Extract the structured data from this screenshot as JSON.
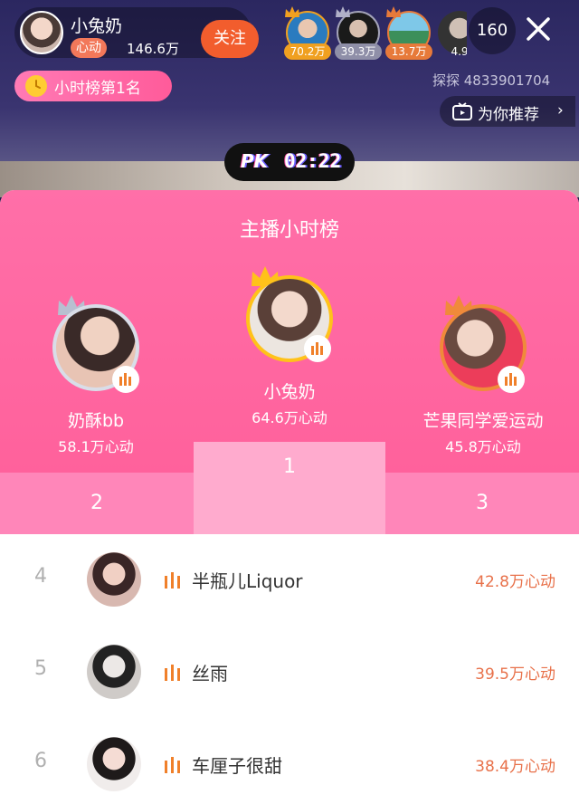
{
  "host": {
    "name": "小兔奶",
    "badge": "心动",
    "value": "146.6万",
    "follow_label": "关注"
  },
  "viewers": [
    {
      "amount": "70.2万",
      "color": "#f0a020"
    },
    {
      "amount": "39.3万",
      "color": "#a3a3b8"
    },
    {
      "amount": "13.7万",
      "color": "#e77a3a"
    },
    {
      "amount": "4.9",
      "color": "#555"
    }
  ],
  "viewer_count": "160",
  "rank_pill": "小时榜第1名",
  "room_id": "探探 4833901704",
  "recommend_label": "为你推荐",
  "pk": {
    "logo": "PK",
    "time": "02:22"
  },
  "panel": {
    "title": "主播小时榜",
    "podium": [
      {
        "rank": "1",
        "name": "小兔奶",
        "score": "64.6万心动"
      },
      {
        "rank": "2",
        "name": "奶酥bb",
        "score": "58.1万心动"
      },
      {
        "rank": "3",
        "name": "芒果同学爱运动",
        "score": "45.8万心动"
      }
    ],
    "list": [
      {
        "rank": "4",
        "name": "半瓶儿Liquor",
        "score": "42.8万心动"
      },
      {
        "rank": "5",
        "name": "丝雨",
        "score": "39.5万心动"
      },
      {
        "rank": "6",
        "name": "车厘子很甜",
        "score": "38.4万心动"
      }
    ]
  },
  "colors": {
    "panel_pink": "#ff5e99",
    "accent_orange": "#f25d2d",
    "score_orange": "#e8714a"
  }
}
